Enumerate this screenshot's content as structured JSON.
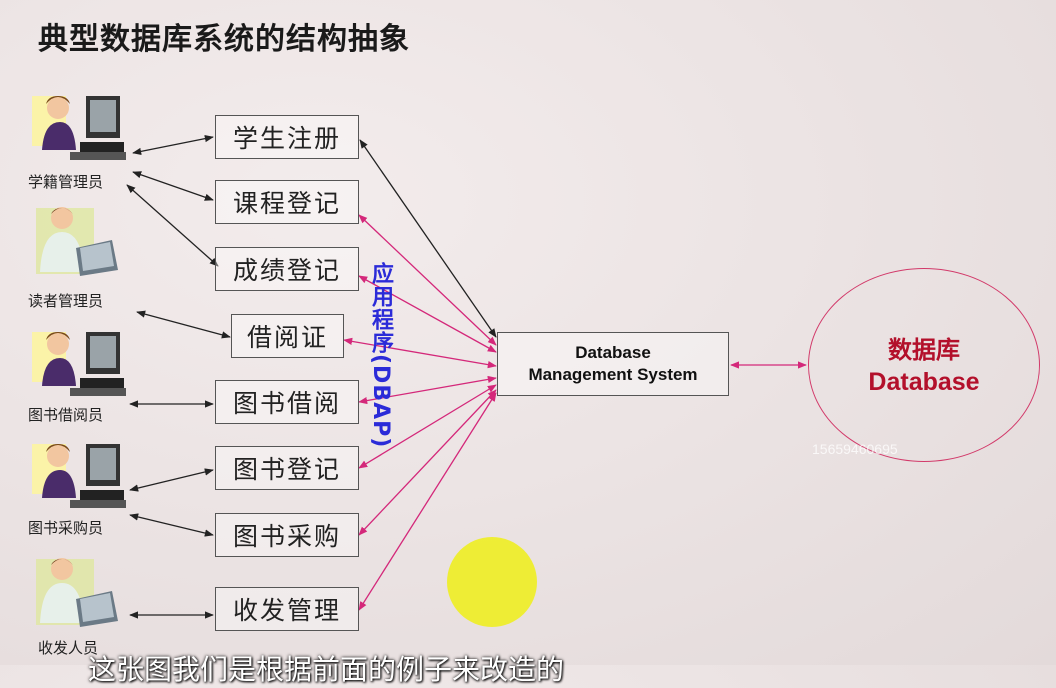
{
  "title": "典型数据库系统的结构抽象",
  "roles": [
    "学籍管理员",
    "读者管理员",
    "图书借阅员",
    "图书采购员",
    "收发人员"
  ],
  "apps": [
    "学生注册",
    "课程登记",
    "成绩登记",
    "借阅证",
    "图书借阅",
    "图书登记",
    "图书采购",
    "收发管理"
  ],
  "app_layer_label": "应用程序(DBAP)",
  "dbms": {
    "line1": "Database",
    "line2": "Management System"
  },
  "database": {
    "zh": "数据库",
    "en": "Database"
  },
  "watermark": "15659460695",
  "subtitle": "这张图我们是根据前面的例子来改造的",
  "colors": {
    "user_arrow": "#222222",
    "app_arrow": "#d4287a",
    "db_label": "#b3102b",
    "dbap_label": "#2b2bd8"
  },
  "icons": [
    "user-at-computer-icon",
    "user-with-laptop-icon"
  ]
}
